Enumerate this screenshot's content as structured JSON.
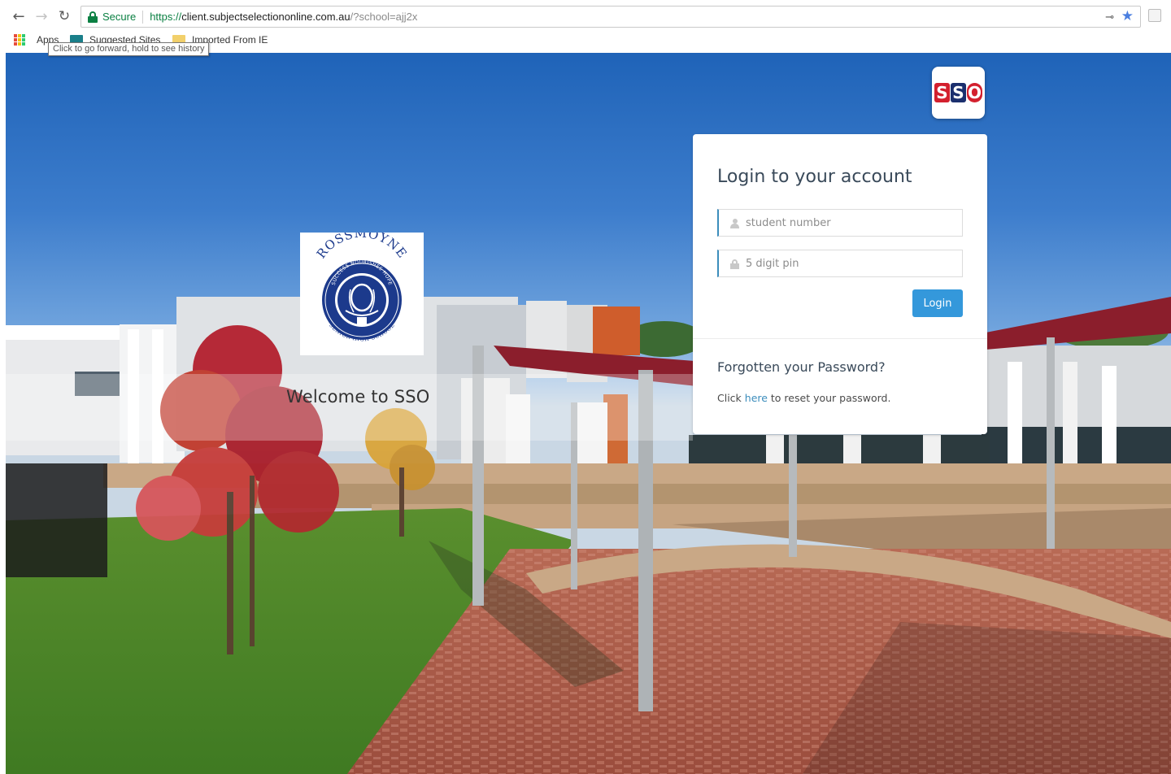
{
  "browser": {
    "secure_label": "Secure",
    "url_scheme": "https://",
    "url_host": "client.subjectselectiononline.com.au",
    "url_path": "/?school=ajj2x",
    "bookmarks": [
      {
        "label": "Apps",
        "icon": "apps-icon"
      },
      {
        "label": "Suggested Sites",
        "icon": "site-icon"
      },
      {
        "label": "Imported From IE",
        "icon": "folder-icon"
      }
    ],
    "tooltip": "Click to go forward, hold to see history"
  },
  "school": {
    "name_arc": "ROSSMOYNE",
    "motto": "SUCCESS NOURISHES HOPE",
    "subtitle": "SENIOR HIGH SCHOOL",
    "brand_color": "#1c3a8c"
  },
  "welcome": {
    "text": "Welcome to SSO"
  },
  "sso_badge": {
    "letters": [
      "S",
      "S",
      "O"
    ],
    "colors": [
      "#d3202e",
      "#1b2f6e",
      "#d3202e"
    ]
  },
  "login": {
    "title": "Login to your account",
    "username_placeholder": "student number",
    "pin_placeholder": "5 digit pin",
    "button_label": "Login",
    "forgot_title": "Forgotten your Password?",
    "forgot_prefix": "Click ",
    "forgot_link": "here",
    "forgot_suffix": " to reset your password.",
    "accent_color": "#3498db"
  }
}
